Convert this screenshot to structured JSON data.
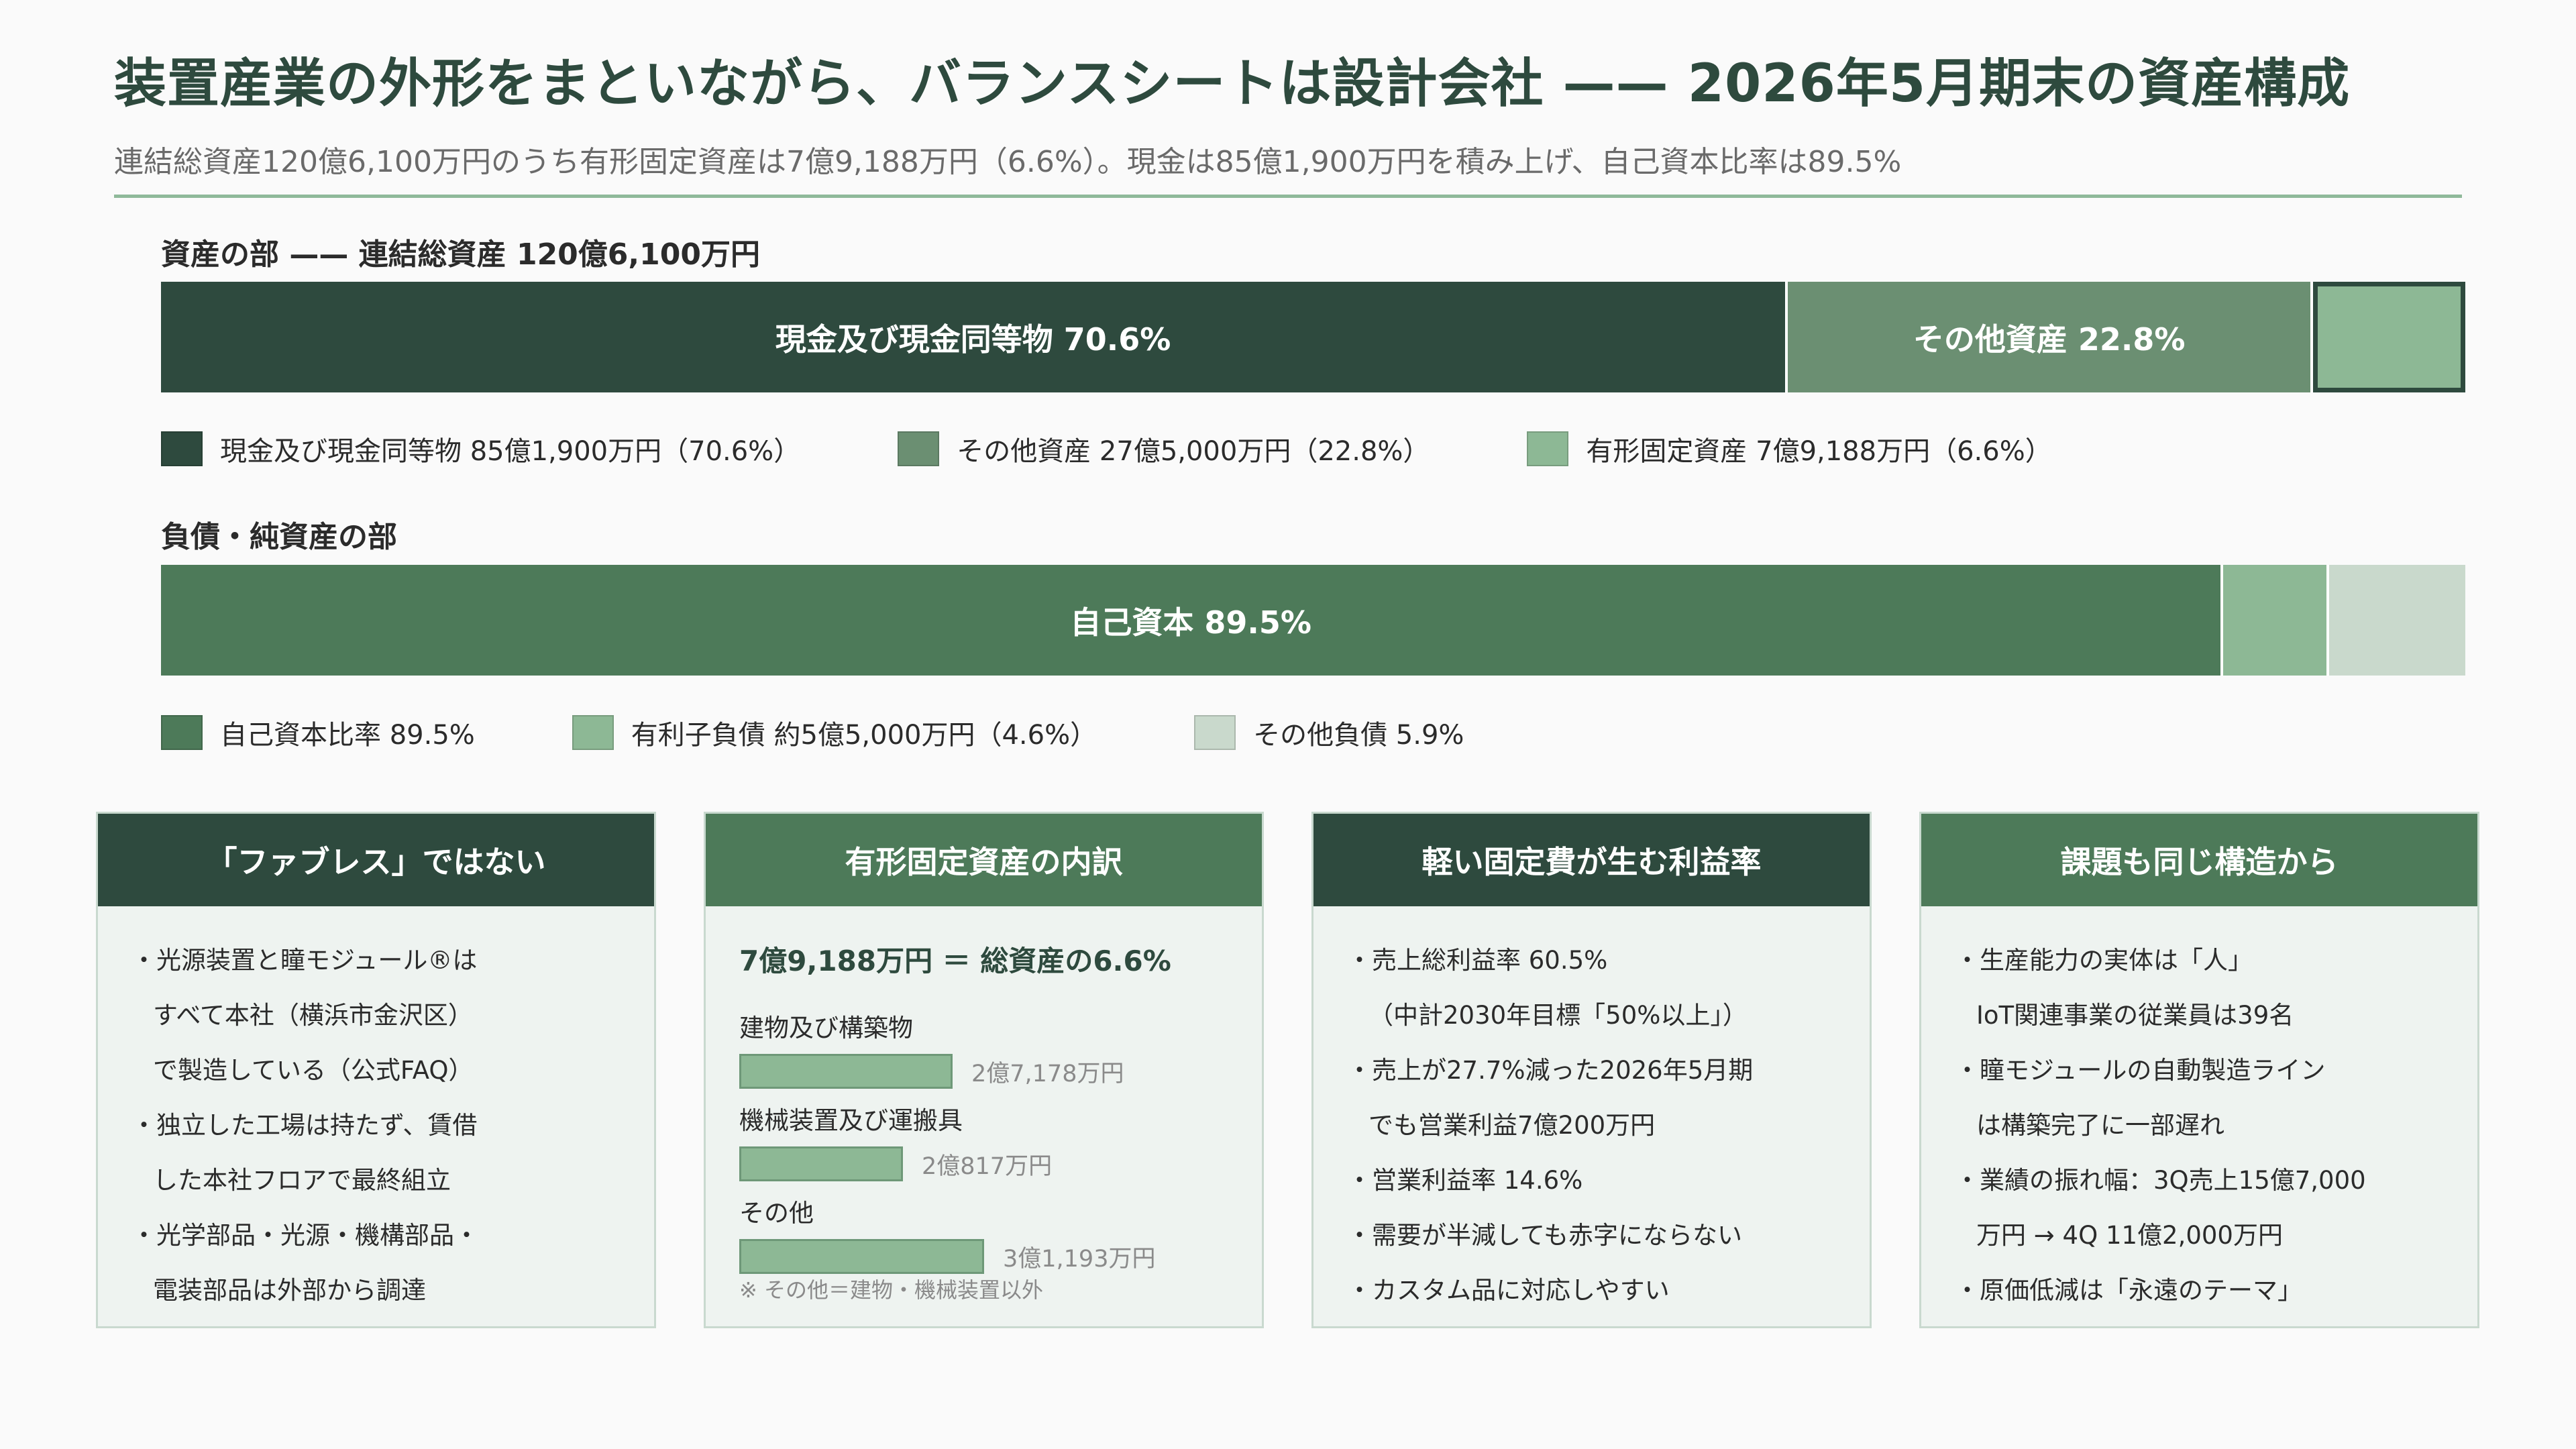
{
  "header": {
    "title": "装置産業の外形をまといながら、バランスシートは設計会社 —— 2026年5月期末の資産構成",
    "subtitle": "連結総資産120億6,100万円のうち有形固定資産は7億9,188万円（6.6%）。現金は85億1,900万円を積み上げ、自己資本比率は89.5%"
  },
  "assets": {
    "label": "資産の部 —— 連結総資産 120億6,100万円",
    "segments": [
      {
        "bar_label": "現金及び現金同等物  70.6%",
        "legend": "現金及び現金同等物   85億1,900万円（70.6%）",
        "color": "#2e4a3e"
      },
      {
        "bar_label": "その他資産  22.8%",
        "legend": "その他資産   27億5,000万円（22.8%）",
        "color": "#6b8f72"
      },
      {
        "bar_label": "",
        "legend": "有形固定資産   7億9,188万円（6.6%）",
        "color": "#8db895"
      }
    ]
  },
  "liabilities": {
    "label": "負債・純資産の部",
    "segments": [
      {
        "bar_label": "自己資本  89.5%",
        "legend": "自己資本比率   89.5%",
        "color": "#4d7a59"
      },
      {
        "bar_label": "",
        "legend": "有利子負債   約5億5,000万円（4.6%）",
        "color": "#8db895"
      },
      {
        "bar_label": "",
        "legend": "その他負債   5.9%",
        "color": "#c9d9cc"
      }
    ]
  },
  "chart_data": [
    {
      "type": "bar",
      "title": "資産の部 —— 連結総資産 120億6,100万円",
      "orientation": "horizontal-stacked",
      "categories": [
        "現金及び現金同等物",
        "その他資産",
        "有形固定資産"
      ],
      "values": [
        70.6,
        22.8,
        6.6
      ],
      "amounts": [
        "85億1,900万円",
        "27億5,000万円",
        "7億9,188万円"
      ],
      "unit": "%"
    },
    {
      "type": "bar",
      "title": "負債・純資産の部",
      "orientation": "horizontal-stacked",
      "categories": [
        "自己資本比率",
        "有利子負債",
        "その他負債"
      ],
      "values": [
        89.5,
        4.6,
        5.9
      ],
      "amounts": [
        "",
        "約5億5,000万円",
        ""
      ],
      "unit": "%"
    },
    {
      "type": "bar",
      "title": "有形固定資産の内訳",
      "orientation": "horizontal",
      "categories": [
        "建物及び構築物",
        "機械装置及び運搬具",
        "その他"
      ],
      "values": [
        27178,
        20817,
        31193
      ],
      "value_labels": [
        "2億7,178万円",
        "2億817万円",
        "3億1,193万円"
      ],
      "unit": "万円"
    }
  ],
  "cards": {
    "fabless": {
      "title": "「ファブレス」ではない",
      "color": "#2e4a3e",
      "lines": [
        {
          "text": "・光源装置と瞳モジュール®は",
          "indent": false
        },
        {
          "text": "すべて本社（横浜市金沢区）",
          "indent": true
        },
        {
          "text": "で製造している（公式FAQ）",
          "indent": true
        },
        {
          "text": "・独立した工場は持たず、賃借",
          "indent": false
        },
        {
          "text": "した本社フロアで最終組立",
          "indent": true
        },
        {
          "text": "・光学部品・光源・機構部品・",
          "indent": false
        },
        {
          "text": "電装部品は外部から調達",
          "indent": true
        }
      ]
    },
    "breakdown": {
      "title": "有形固定資産の内訳",
      "color": "#4d7a59",
      "lead": "7億9,188万円 ＝ 総資産の6.6%",
      "note": "※ その他＝建物・機械装置以外"
    },
    "margin": {
      "title": "軽い固定費が生む利益率",
      "color": "#2e4a3e",
      "lines": [
        {
          "text": "・売上総利益率 60.5%",
          "indent": false
        },
        {
          "text": "（中計2030年目標「50%以上」）",
          "indent": true
        },
        {
          "text": "・売上が27.7%減った2026年5月期",
          "indent": false
        },
        {
          "text": "でも営業利益7億200万円",
          "indent": true
        },
        {
          "text": "・営業利益率 14.6%",
          "indent": false
        },
        {
          "text": "・需要が半減しても赤字にならない",
          "indent": false
        },
        {
          "text": "・カスタム品に対応しやすい",
          "indent": false
        }
      ]
    },
    "issues": {
      "title": "課題も同じ構造から",
      "color": "#4d7a59",
      "lines": [
        {
          "text": "・生産能力の実体は「人」",
          "indent": false
        },
        {
          "text": "IoT関連事業の従業員は39名",
          "indent": true
        },
        {
          "text": "・瞳モジュールの自動製造ライン",
          "indent": false
        },
        {
          "text": "は構築完了に一部遅れ",
          "indent": true
        },
        {
          "text": "・業績の振れ幅：3Q売上15億7,000",
          "indent": false
        },
        {
          "text": "万円 → 4Q 11億2,000万円",
          "indent": true
        },
        {
          "text": "・原価低減は「永遠のテーマ」",
          "indent": false
        }
      ]
    }
  }
}
